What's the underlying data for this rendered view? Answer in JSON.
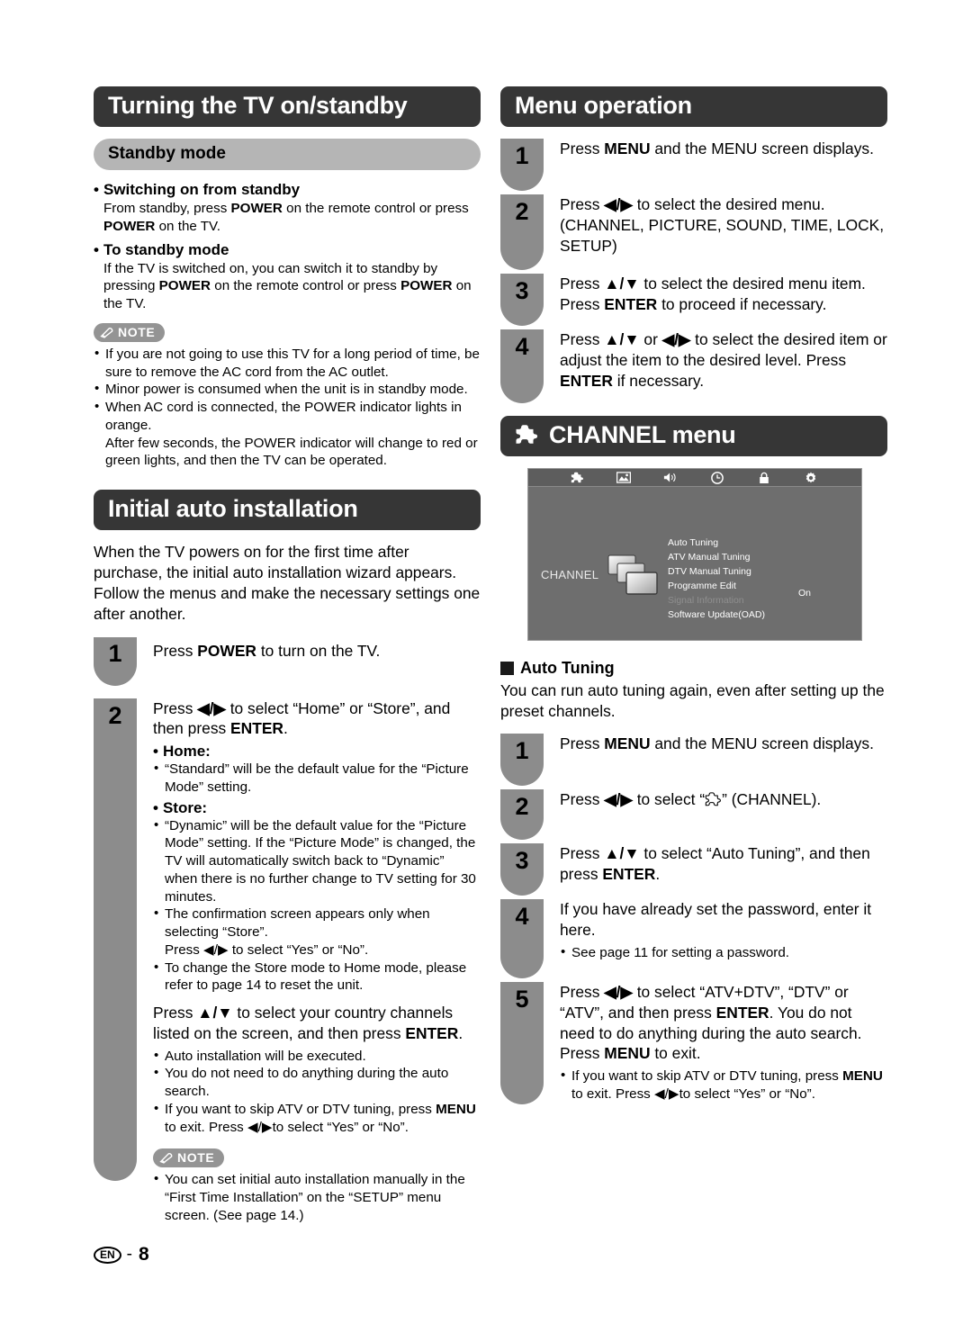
{
  "left": {
    "section1": {
      "title": "Turning the TV on/standby",
      "subhead": "Standby mode",
      "items": [
        {
          "heading": "Switching on from standby",
          "body_html": "From standby, press <b>POWER</b> on the remote control or press <b>POWER</b> on the TV."
        },
        {
          "heading": "To standby mode",
          "body_html": "If the TV is switched on, you can switch it to standby by pressing <b>POWER</b> on the remote control or press <b>POWER</b> on the TV."
        }
      ],
      "note_label": "NOTE",
      "notes": [
        "If you are not going to use this TV for a long period of time, be sure to remove the AC cord from the AC outlet.",
        "Minor power is consumed when the unit is in standby mode.",
        "When AC cord is connected, the POWER indicator lights in orange.\nAfter few seconds, the POWER indicator will change to red or green lights, and then the TV can be operated."
      ]
    },
    "section2": {
      "title": "Initial auto installation",
      "intro": "When the TV powers on for the first time after purchase, the initial auto installation wizard appears. Follow the menus and make the necessary settings one after another.",
      "step1_num": "1",
      "step1_html": "Press <b>POWER</b> to turn on the TV.",
      "step2_num": "2",
      "step2_html": "Press <b>◀/▶</b> to select “Home” or “Store”, and then press <b>ENTER</b>.",
      "home_label": "Home:",
      "home_bullets": [
        "“Standard” will be the default value for the “Picture Mode” setting."
      ],
      "store_label": "Store:",
      "store_bullets": [
        "“Dynamic” will be the default value for the “Picture Mode” setting. If the “Picture Mode” is changed, the TV will automatically switch back to “Dynamic” when there is no further change to TV setting for 30 minutes.",
        "The confirmation screen appears only when selecting “Store”.\nPress ◀/▶ to select “Yes” or “No”.",
        "To change the Store mode to Home mode, please refer to page 14 to reset the unit."
      ],
      "country_html": "Press <b>▲/▼</b> to select your country channels listed on the screen, and then press <b>ENTER</b>.",
      "country_bullets_html": [
        "Auto installation will be executed.",
        "You do not need to do anything during the auto search.",
        "If you want to skip ATV or DTV tuning, press <b>MENU</b> to exit. Press ◀/▶to select “Yes” or “No”."
      ],
      "note_label": "NOTE",
      "notes": [
        "You can set initial auto installation manually in the “First Time Installation” on the “SETUP” menu screen. (See page 14.)"
      ]
    }
  },
  "right": {
    "menu_operation": {
      "title": "Menu operation",
      "steps": [
        {
          "num": "1",
          "html": "Press <b>MENU</b> and the MENU screen displays."
        },
        {
          "num": "2",
          "html": "Press <b>◀/▶</b> to select the desired menu. (CHANNEL, PICTURE, SOUND, TIME, LOCK, SETUP)"
        },
        {
          "num": "3",
          "html": "Press <b>▲/▼</b> to select the desired menu item. Press <b>ENTER</b> to proceed if necessary."
        },
        {
          "num": "4",
          "html": "Press <b>▲/▼</b> or <b>◀/▶</b> to select the desired item or adjust the item to the desired level. Press <b>ENTER</b> if necessary."
        }
      ]
    },
    "channel_menu": {
      "title": "CHANNEL menu",
      "icon": "puzzle-piece-icon",
      "tv_screen": {
        "tab_icons": [
          "puzzle-piece-icon",
          "picture-icon",
          "speaker-icon",
          "clock-icon",
          "lock-icon",
          "gear-icon"
        ],
        "category_label": "CHANNEL",
        "menu_items": [
          {
            "label": "Auto Tuning",
            "disabled": false,
            "value": ""
          },
          {
            "label": "ATV Manual Tuning",
            "disabled": false,
            "value": ""
          },
          {
            "label": "DTV Manual Tuning",
            "disabled": false,
            "value": ""
          },
          {
            "label": "Programme Edit",
            "disabled": false,
            "value": ""
          },
          {
            "label": "Signal Information",
            "disabled": true,
            "value": ""
          },
          {
            "label": "Software Update(OAD)",
            "disabled": false,
            "value": "On"
          }
        ],
        "software_update_value": "On"
      },
      "auto_tuning": {
        "heading": "Auto Tuning",
        "intro": "You can run auto tuning again, even after setting up the preset channels.",
        "steps": [
          {
            "num": "1",
            "html": "Press <b>MENU</b> and the MENU screen displays."
          },
          {
            "num": "2",
            "html": "Press <b>◀/▶</b> to select “<span class=\"inline-puz\"></span>” (CHANNEL)."
          },
          {
            "num": "3",
            "html": "Press <b>▲/▼</b> to select “Auto Tuning”, and then press <b>ENTER</b>."
          },
          {
            "num": "4",
            "html": "If you have already set the password, enter it here.",
            "bullets": [
              "See page 11 for setting a password."
            ]
          },
          {
            "num": "5",
            "html": "Press <b>◀/▶</b> to select “ATV+DTV”, “DTV” or “ATV”, and then press <b>ENTER</b>. You do not need to do anything during the auto search. Press <b>MENU</b> to exit.",
            "bullets_html": [
              "If you want to skip ATV or DTV tuning, press <b>MENU</b> to exit. Press ◀/▶to select “Yes” or “No”."
            ]
          }
        ]
      }
    }
  },
  "footer": {
    "lang": "EN",
    "dash": "-",
    "page": "8"
  },
  "colors": {
    "header_bg": "#363636",
    "subhead_bg": "#b5b5b5",
    "shield_bg": "#8c8c8c",
    "note_bg": "#949494",
    "tv_bg": "#6e6e6e",
    "tv_bar": "#5d5d5d"
  }
}
